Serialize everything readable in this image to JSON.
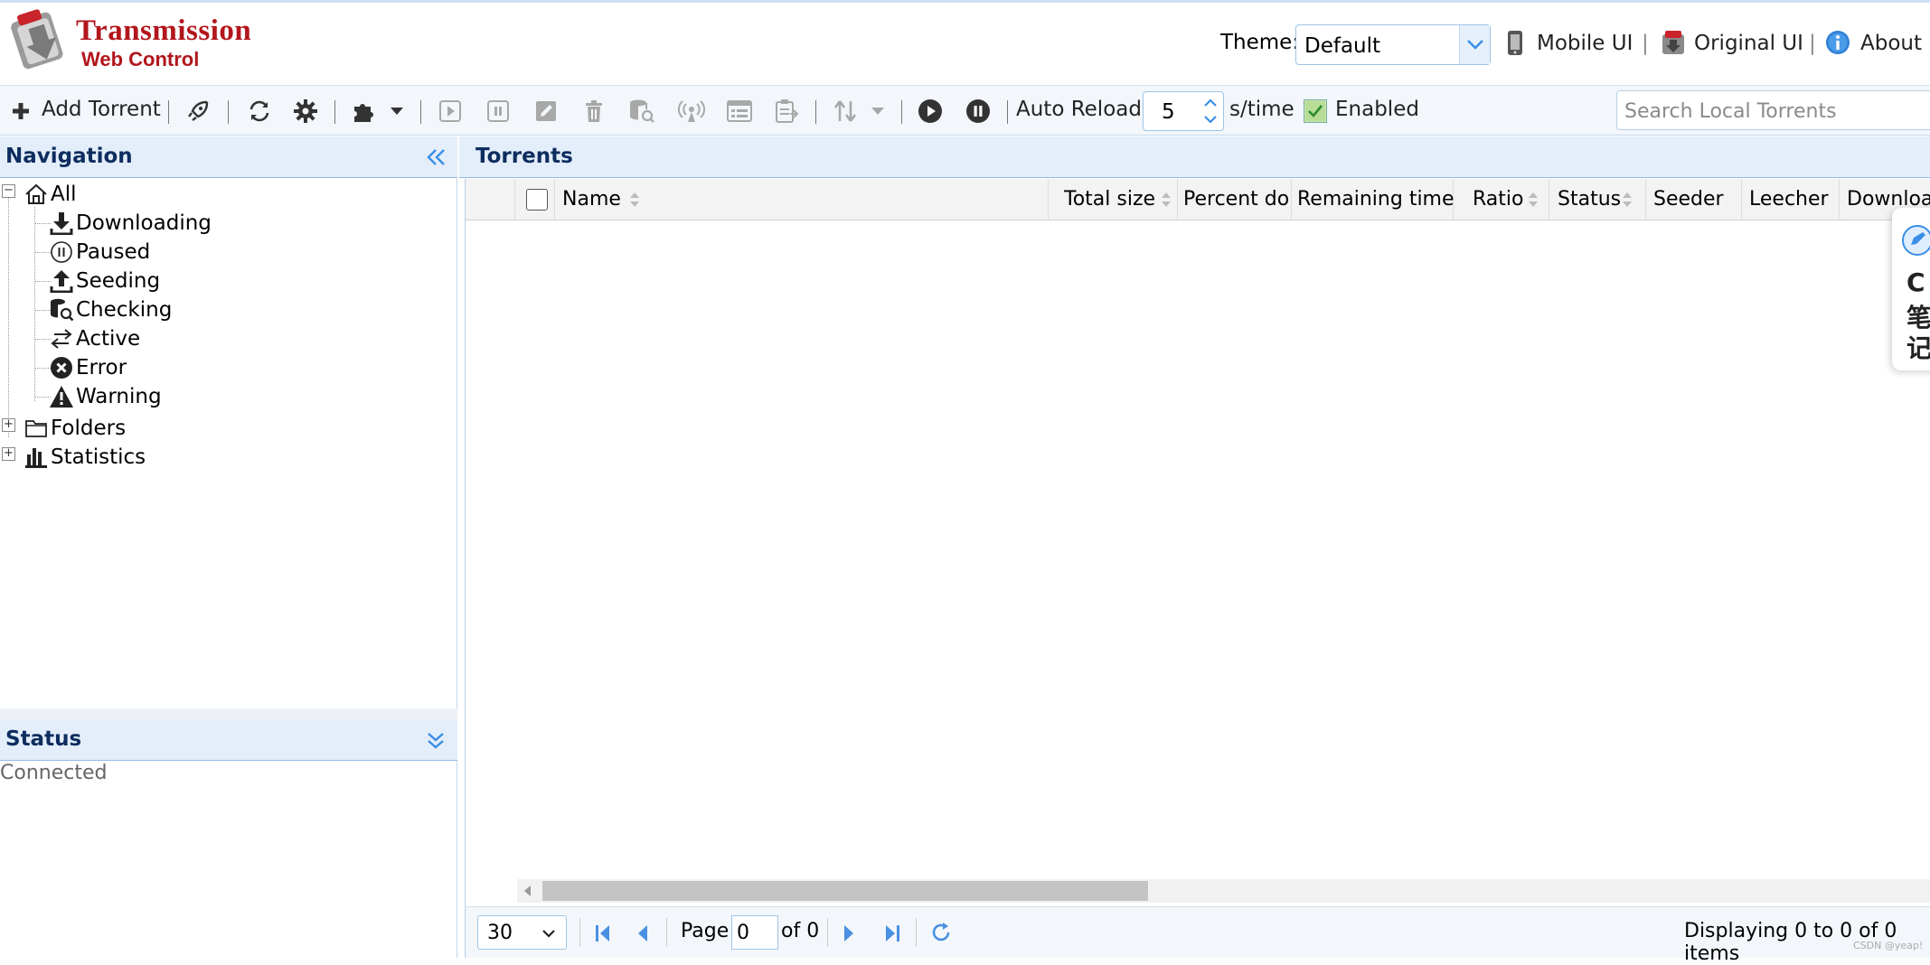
{
  "app": {
    "title": "Transmission",
    "subtitle": "Web Control"
  },
  "header": {
    "theme_label": "Theme:",
    "theme_value": "Default",
    "links": [
      {
        "label": "Mobile UI",
        "icon": "mobile-phone-icon"
      },
      {
        "label": "Original UI",
        "icon": "transmission-icon"
      },
      {
        "label": "About",
        "icon": "info-icon"
      }
    ],
    "separator": "|"
  },
  "toolbar": {
    "add_torrent": "Add Torrent",
    "auto_reload_label": "Auto Reload:",
    "auto_reload_value": "5",
    "auto_reload_unit": "s/time",
    "enabled_label": "Enabled",
    "enabled_checked": true,
    "search_placeholder": "Search Local Torrents"
  },
  "navigation": {
    "title": "Navigation",
    "root": "All",
    "items": [
      {
        "label": "Downloading",
        "icon": "download-icon"
      },
      {
        "label": "Paused",
        "icon": "pause-circle-icon"
      },
      {
        "label": "Seeding",
        "icon": "upload-icon"
      },
      {
        "label": "Checking",
        "icon": "database-search-icon"
      },
      {
        "label": "Active",
        "icon": "exchange-icon"
      },
      {
        "label": "Error",
        "icon": "error-circle-icon"
      },
      {
        "label": "Warning",
        "icon": "warning-triangle-icon"
      }
    ],
    "folders": "Folders",
    "statistics": "Statistics"
  },
  "status": {
    "title": "Status",
    "text": "Connected"
  },
  "torrents": {
    "title": "Torrents",
    "columns": [
      "Name",
      "Total size",
      "Percent done",
      "Remaining time",
      "Ratio",
      "Status",
      "Seeder",
      "Leecher",
      "Download"
    ]
  },
  "pager": {
    "page_size": "30",
    "page_label": "Page",
    "page_value": "0",
    "of_label": "of 0",
    "displaying": "Displaying 0 to 0 of 0 items"
  },
  "side_widget": {
    "chars": [
      "C",
      "笔",
      "记"
    ]
  },
  "watermark": "CSDN @yeap!",
  "colors": {
    "brand_red": "#b2161c",
    "panel_header_bg": "#e3eefa",
    "panel_header_text": "#0e2d5f"
  }
}
